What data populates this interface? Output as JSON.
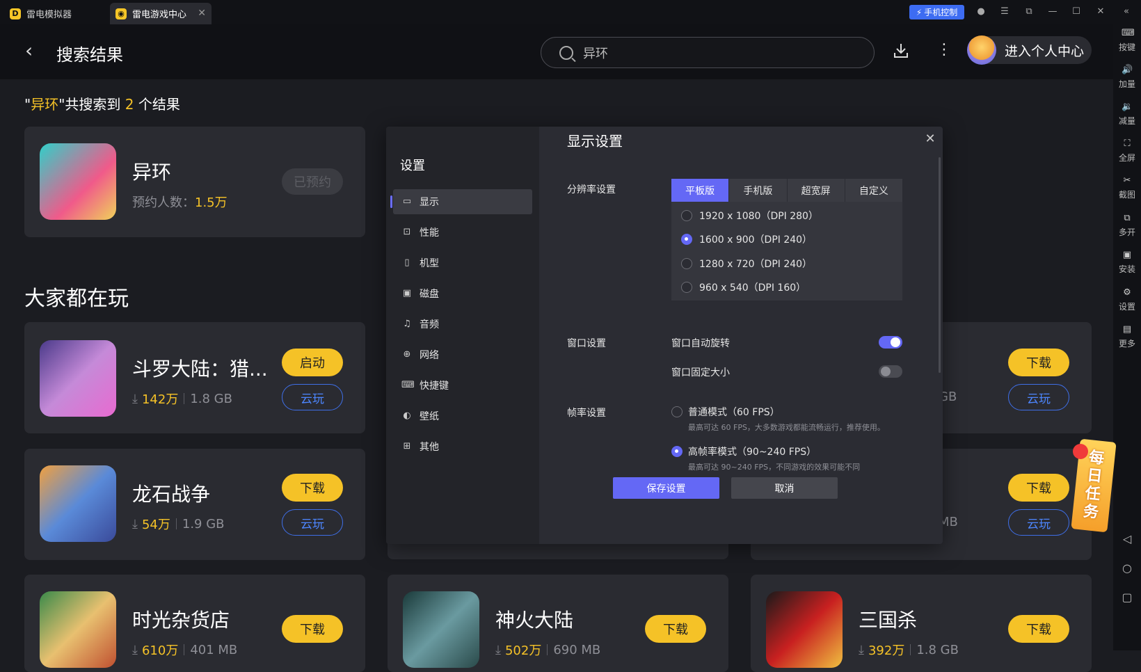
{
  "titlebar": {
    "tab1_label": "雷电模拟器",
    "tab2_label": "雷电游戏中心",
    "phone_control": "手机控制"
  },
  "header": {
    "page_title": "搜索结果",
    "search_value": "异环",
    "user_center": "进入个人中心"
  },
  "results": {
    "prefix": "\"",
    "keyword": "异环",
    "middle": "\"共搜索到 ",
    "count": "2",
    "suffix": " 个结果"
  },
  "top_result": {
    "name": "异环",
    "meta_label": "预约人数：",
    "meta_value": "1.5万",
    "button": "已预约"
  },
  "section_title": "大家都在玩",
  "games": [
    {
      "name": "斗罗大陆：猎...",
      "downloads": "142万",
      "size": "1.8 GB",
      "primary": "启动",
      "cloud": "云玩"
    },
    {
      "name": "龙石战争",
      "downloads": "54万",
      "size": "1.9 GB",
      "primary": "下载",
      "cloud": "云玩"
    },
    {
      "name": "时光杂货店",
      "downloads": "610万",
      "size": "401 MB",
      "primary": "下载"
    },
    {
      "name": "神火大陆",
      "downloads": "502万",
      "size": "690 MB",
      "primary": "下载"
    },
    {
      "name": "三国杀",
      "downloads": "392万",
      "size": "1.8 GB",
      "primary": "下载"
    }
  ],
  "right_cards": {
    "row1": {
      "size_tail": "GB",
      "primary": "下载",
      "cloud": "云玩"
    },
    "row2": {
      "size_tail": "MB",
      "primary": "下载",
      "cloud": "云玩"
    }
  },
  "rightbar": [
    "按键",
    "加量",
    "减量",
    "全屏",
    "截图",
    "多开",
    "安装",
    "设置",
    "更多"
  ],
  "settings": {
    "title": "设置",
    "nav": [
      "显示",
      "性能",
      "机型",
      "磁盘",
      "音频",
      "网络",
      "快捷键",
      "壁纸",
      "其他"
    ],
    "section_heading": "显示设置",
    "resolution_label": "分辨率设置",
    "resolution_tabs": [
      "平板版",
      "手机版",
      "超宽屏",
      "自定义"
    ],
    "resolutions": [
      {
        "label": "1920 x 1080（DPI 280）",
        "selected": false
      },
      {
        "label": "1600 x 900（DPI 240）",
        "selected": true
      },
      {
        "label": "1280 x 720（DPI 240）",
        "selected": false
      },
      {
        "label": "960 x 540（DPI 160）",
        "selected": false
      }
    ],
    "window_label": "窗口设置",
    "auto_rotate": "窗口自动旋转",
    "auto_rotate_on": true,
    "fixed_size": "窗口固定大小",
    "fixed_size_on": false,
    "fps_label": "帧率设置",
    "fps_normal": "普通模式（60 FPS）",
    "fps_normal_desc": "最高可达 60 FPS，大多数游戏都能流畅运行，推荐使用。",
    "fps_high": "高帧率模式（90~240 FPS）",
    "fps_high_desc": "最高可达 90~240 FPS，不同游戏的效果可能不同",
    "save": "保存设置",
    "cancel": "取消"
  },
  "daily_task": [
    "每",
    "日",
    "任",
    "务"
  ],
  "colors": {
    "accent_yellow": "#f5c227",
    "accent_purple": "#6468f5",
    "cloud_blue": "#3f6fe8"
  }
}
